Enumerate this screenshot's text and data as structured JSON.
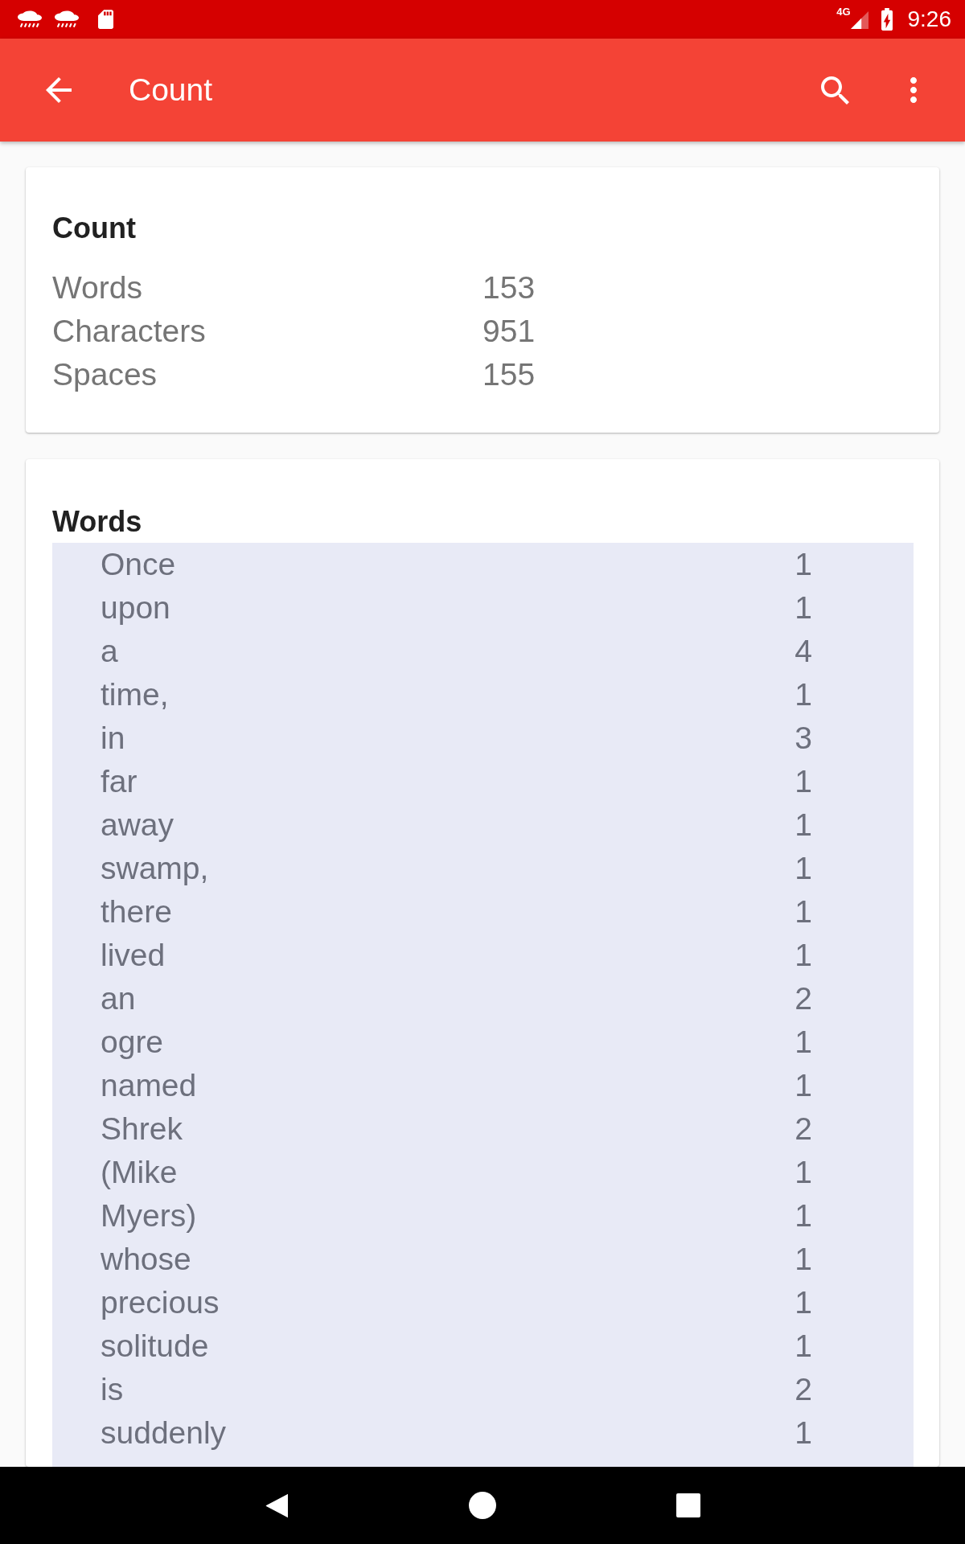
{
  "status_bar": {
    "network_type": "4G",
    "time": "9:26"
  },
  "app_bar": {
    "title": "Count"
  },
  "summary": {
    "title": "Count",
    "rows": [
      {
        "label": "Words",
        "value": "153"
      },
      {
        "label": "Characters",
        "value": "951"
      },
      {
        "label": "Spaces",
        "value": "155"
      }
    ]
  },
  "words": {
    "title": "Words",
    "rows": [
      {
        "word": "Once",
        "count": "1"
      },
      {
        "word": "upon",
        "count": "1"
      },
      {
        "word": "a",
        "count": "4"
      },
      {
        "word": "time,",
        "count": "1"
      },
      {
        "word": "in",
        "count": "3"
      },
      {
        "word": "far",
        "count": "1"
      },
      {
        "word": "away",
        "count": "1"
      },
      {
        "word": "swamp,",
        "count": "1"
      },
      {
        "word": "there",
        "count": "1"
      },
      {
        "word": "lived",
        "count": "1"
      },
      {
        "word": "an",
        "count": "2"
      },
      {
        "word": "ogre",
        "count": "1"
      },
      {
        "word": "named",
        "count": "1"
      },
      {
        "word": "Shrek",
        "count": "2"
      },
      {
        "word": "(Mike",
        "count": "1"
      },
      {
        "word": "Myers)",
        "count": "1"
      },
      {
        "word": "whose",
        "count": "1"
      },
      {
        "word": "precious",
        "count": "1"
      },
      {
        "word": "solitude",
        "count": "1"
      },
      {
        "word": "is",
        "count": "2"
      },
      {
        "word": "suddenly",
        "count": "1"
      }
    ]
  }
}
